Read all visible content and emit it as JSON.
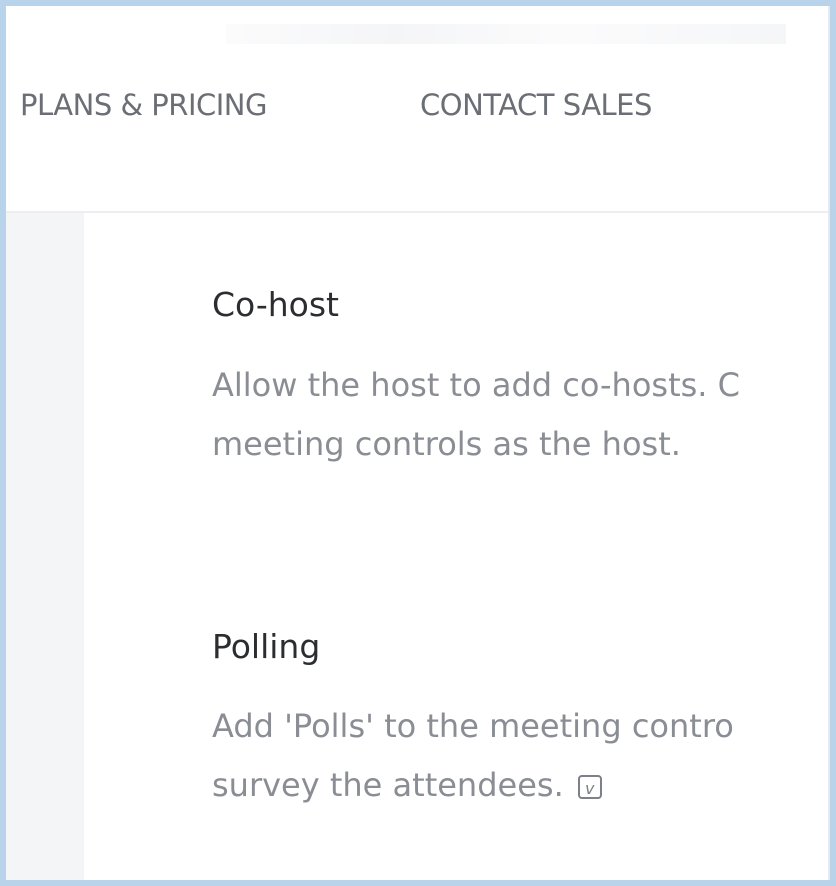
{
  "nav": {
    "items": [
      {
        "label": "PLANS & PRICING"
      },
      {
        "label": "CONTACT SALES"
      }
    ]
  },
  "settings": [
    {
      "title": "Co-host",
      "desc_line1": "Allow the host to add co-hosts. C",
      "desc_line2": "meeting controls as the host."
    },
    {
      "title": "Polling",
      "desc_line1": "Add 'Polls' to the meeting contro",
      "desc_line2": "survey the attendees.",
      "info_icon": "v"
    }
  ],
  "icons": {
    "info": "info-icon"
  },
  "colors": {
    "background_frame": "#b9d3ea",
    "nav_text": "#6b6e75",
    "title_text": "#2b2d31",
    "desc_text": "#8a8d94"
  }
}
